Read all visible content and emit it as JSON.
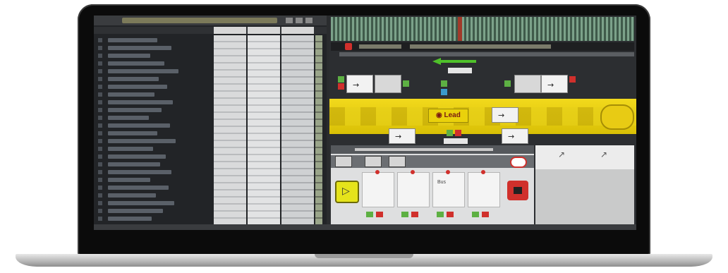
{
  "device": "laptop",
  "app": {
    "left_panel": {
      "track_count": 24
    },
    "deck": {
      "yellow_band_label": "◉ Lead",
      "pads": [
        {
          "label": ""
        },
        {
          "label": ""
        },
        {
          "label": "Bus"
        },
        {
          "label": ""
        }
      ]
    }
  },
  "colors": {
    "accent_yellow": "#f2d91c",
    "alert_red": "#d0302c",
    "ok_green": "#5db043",
    "waveform": "#7ca28a"
  },
  "icons": [
    "play-icon",
    "stop-icon",
    "arrow-right-icon",
    "record-icon"
  ]
}
